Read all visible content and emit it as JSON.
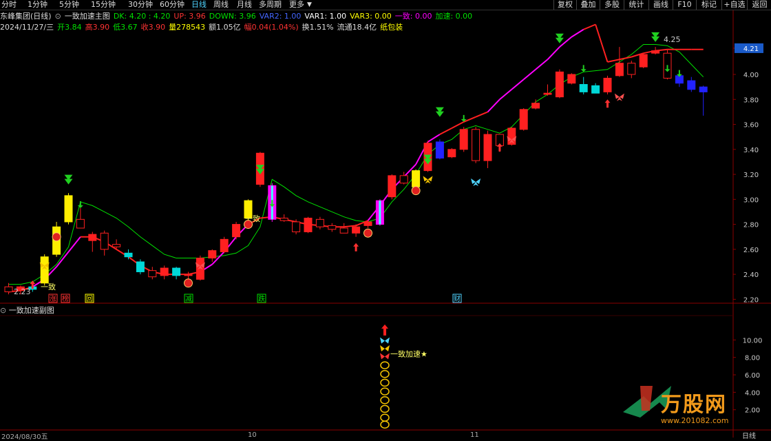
{
  "toolbar": {
    "tabs": [
      "分时",
      "1分钟",
      "5分钟",
      "15分钟",
      "30分钟",
      "60分钟",
      "日线",
      "周线",
      "月线",
      "多周期",
      "更多"
    ],
    "active_tab": "日线",
    "right_buttons": [
      "复权",
      "叠加",
      "多股",
      "统计",
      "画线",
      "F10",
      "标记",
      "+自选",
      "返回"
    ]
  },
  "header": {
    "stock": "东峰集团(日线)",
    "indicator_name": "一致加速主图",
    "values": [
      {
        "label": "DK: 4.20 : 4.20",
        "color": "#00e000"
      },
      {
        "label": "UP: 3.96",
        "color": "#ff3333"
      },
      {
        "label": "DOWN: 3.96",
        "color": "#00e000"
      },
      {
        "label": "VAR2: 1.00",
        "color": "#4466ff"
      },
      {
        "label": "VAR1: 1.00",
        "color": "#ffffff"
      },
      {
        "label": "VAR3: 0.00",
        "color": "#ffff00"
      },
      {
        "label": "一致: 0.00",
        "color": "#ff00ff"
      },
      {
        "label": "加速: 0.00",
        "color": "#00e000"
      }
    ],
    "quote": [
      {
        "label": "2024/11/27/三",
        "color": "#dddddd"
      },
      {
        "label": "开3.84",
        "color": "#00e000"
      },
      {
        "label": "高3.90",
        "color": "#ff3333"
      },
      {
        "label": "低3.67",
        "color": "#00e000"
      },
      {
        "label": "收3.90",
        "color": "#ff3333"
      },
      {
        "label": "量278543",
        "color": "#ffff00"
      },
      {
        "label": "额1.05亿",
        "color": "#dddddd"
      },
      {
        "label": "幅0.04(1.04%)",
        "color": "#ff3333"
      },
      {
        "label": "换1.51%",
        "color": "#dddddd"
      },
      {
        "label": "流通18.4亿",
        "color": "#dddddd"
      },
      {
        "label": "纸包装",
        "color": "#ffff00"
      }
    ]
  },
  "sub_header": "一致加速副图",
  "date_start": "2024/08/30五",
  "month_labels": [
    "10",
    "11"
  ],
  "period_label": "日线",
  "watermark": {
    "text": "万股网",
    "url": "www.201082.com"
  },
  "annotations": {
    "yizhi_1": "一致",
    "yizhi_2": "一致",
    "accel": "一致加速★",
    "start_price": "2.23",
    "end_price": "4.25",
    "last_price": "4.21"
  },
  "event_labels": [
    {
      "text": "涨",
      "color": "#ff3333"
    },
    {
      "text": "榜",
      "color": "#ff3333"
    },
    {
      "text": "回",
      "color": "#ffff00"
    },
    {
      "text": "减",
      "color": "#00e000"
    },
    {
      "text": "跌",
      "color": "#00e000"
    },
    {
      "text": "财",
      "color": "#4fd4ff"
    }
  ],
  "colors": {
    "up": "#ff2020",
    "down": "#00d8d8",
    "yellow": "#ffee00",
    "magenta": "#ff00ff",
    "blue": "#2222ff",
    "ma": "#00e000",
    "trend": "#ff2020",
    "grid": "#8b0000"
  },
  "chart_data": {
    "type": "candlestick",
    "y_range": [
      2.18,
      4.32
    ],
    "y_ticks": [
      "4.21",
      "4.00",
      "3.80",
      "3.60",
      "3.40",
      "3.20",
      "3.00",
      "2.80",
      "2.60",
      "2.40",
      "2.20"
    ],
    "sub_y_range": [
      0,
      12
    ],
    "sub_y_ticks": [
      "10.00",
      "8.00",
      "6.00",
      "4.00",
      "2.00"
    ],
    "candles": [
      {
        "o": 2.3,
        "h": 2.33,
        "l": 2.24,
        "c": 2.26,
        "k": "up"
      },
      {
        "o": 2.27,
        "h": 2.31,
        "l": 2.24,
        "c": 2.3,
        "k": "up"
      },
      {
        "o": 2.3,
        "h": 2.34,
        "l": 2.26,
        "c": 2.28,
        "k": "down"
      },
      {
        "o": 2.33,
        "h": 2.56,
        "l": 2.31,
        "c": 2.54,
        "k": "yel"
      },
      {
        "o": 2.56,
        "h": 2.82,
        "l": 2.54,
        "c": 2.78,
        "k": "yel"
      },
      {
        "o": 2.82,
        "h": 3.05,
        "l": 2.8,
        "c": 3.03,
        "k": "yel"
      },
      {
        "o": 2.84,
        "h": 2.93,
        "l": 2.8,
        "c": 2.77,
        "k": "up"
      },
      {
        "o": 2.67,
        "h": 2.74,
        "l": 2.58,
        "c": 2.72,
        "k": "up"
      },
      {
        "o": 2.73,
        "h": 2.75,
        "l": 2.55,
        "c": 2.6,
        "k": "up"
      },
      {
        "o": 2.64,
        "h": 2.68,
        "l": 2.6,
        "c": 2.62,
        "k": "up"
      },
      {
        "o": 2.57,
        "h": 2.6,
        "l": 2.52,
        "c": 2.54,
        "k": "down"
      },
      {
        "o": 2.5,
        "h": 2.52,
        "l": 2.4,
        "c": 2.42,
        "k": "down"
      },
      {
        "o": 2.43,
        "h": 2.46,
        "l": 2.36,
        "c": 2.38,
        "k": "up"
      },
      {
        "o": 2.39,
        "h": 2.47,
        "l": 2.36,
        "c": 2.45,
        "k": "up"
      },
      {
        "o": 2.45,
        "h": 2.46,
        "l": 2.36,
        "c": 2.39,
        "k": "down"
      },
      {
        "o": 2.39,
        "h": 2.42,
        "l": 2.36,
        "c": 2.4,
        "k": "up"
      },
      {
        "o": 2.36,
        "h": 2.55,
        "l": 2.35,
        "c": 2.53,
        "k": "up"
      },
      {
        "o": 2.53,
        "h": 2.6,
        "l": 2.5,
        "c": 2.59,
        "k": "up"
      },
      {
        "o": 2.58,
        "h": 2.7,
        "l": 2.57,
        "c": 2.68,
        "k": "up"
      },
      {
        "o": 2.7,
        "h": 2.82,
        "l": 2.68,
        "c": 2.8,
        "k": "up"
      },
      {
        "o": 2.85,
        "h": 3.0,
        "l": 2.82,
        "c": 2.99,
        "k": "yel"
      },
      {
        "o": 3.12,
        "h": 3.38,
        "l": 3.1,
        "c": 3.37,
        "k": "up"
      },
      {
        "o": 3.11,
        "h": 3.13,
        "l": 2.82,
        "c": 2.84,
        "k": "mag"
      },
      {
        "o": 2.85,
        "h": 2.88,
        "l": 2.82,
        "c": 2.83,
        "k": "up"
      },
      {
        "o": 2.82,
        "h": 2.84,
        "l": 2.72,
        "c": 2.74,
        "k": "up"
      },
      {
        "o": 2.74,
        "h": 2.86,
        "l": 2.73,
        "c": 2.85,
        "k": "up"
      },
      {
        "o": 2.84,
        "h": 2.86,
        "l": 2.76,
        "c": 2.78,
        "k": "up"
      },
      {
        "o": 2.79,
        "h": 2.81,
        "l": 2.74,
        "c": 2.76,
        "k": "up"
      },
      {
        "o": 2.77,
        "h": 2.81,
        "l": 2.73,
        "c": 2.73,
        "k": "up"
      },
      {
        "o": 2.73,
        "h": 2.8,
        "l": 2.7,
        "c": 2.78,
        "k": "up"
      },
      {
        "o": 2.79,
        "h": 2.83,
        "l": 2.77,
        "c": 2.82,
        "k": "up"
      },
      {
        "o": 2.8,
        "h": 3.0,
        "l": 2.79,
        "c": 2.99,
        "k": "mag"
      },
      {
        "o": 3.02,
        "h": 3.2,
        "l": 3.0,
        "c": 3.19,
        "k": "up"
      },
      {
        "o": 3.19,
        "h": 3.22,
        "l": 3.12,
        "c": 3.13,
        "k": "up"
      },
      {
        "o": 3.1,
        "h": 3.24,
        "l": 3.09,
        "c": 3.23,
        "k": "yel"
      },
      {
        "o": 3.23,
        "h": 3.47,
        "l": 3.22,
        "c": 3.45,
        "k": "up"
      },
      {
        "o": 3.46,
        "h": 3.48,
        "l": 3.32,
        "c": 3.33,
        "k": "blue"
      },
      {
        "o": 3.34,
        "h": 3.41,
        "l": 3.33,
        "c": 3.4,
        "k": "up"
      },
      {
        "o": 3.4,
        "h": 3.58,
        "l": 3.38,
        "c": 3.56,
        "k": "up"
      },
      {
        "o": 3.56,
        "h": 3.58,
        "l": 3.29,
        "c": 3.31,
        "k": "up"
      },
      {
        "o": 3.31,
        "h": 3.55,
        "l": 3.25,
        "c": 3.52,
        "k": "up"
      },
      {
        "o": 3.52,
        "h": 3.48,
        "l": 3.38,
        "c": 3.43,
        "k": "up"
      },
      {
        "o": 3.44,
        "h": 3.58,
        "l": 3.43,
        "c": 3.57,
        "k": "up"
      },
      {
        "o": 3.56,
        "h": 3.73,
        "l": 3.55,
        "c": 3.72,
        "k": "up"
      },
      {
        "o": 3.73,
        "h": 3.8,
        "l": 3.72,
        "c": 3.77,
        "k": "up"
      },
      {
        "o": 3.84,
        "h": 3.92,
        "l": 3.83,
        "c": 3.85,
        "k": "up"
      },
      {
        "o": 3.82,
        "h": 4.04,
        "l": 3.81,
        "c": 4.02,
        "k": "up"
      },
      {
        "o": 3.93,
        "h": 4.01,
        "l": 3.92,
        "c": 4.0,
        "k": "up"
      },
      {
        "o": 3.92,
        "h": 3.98,
        "l": 3.84,
        "c": 3.86,
        "k": "down"
      },
      {
        "o": 3.91,
        "h": 3.93,
        "l": 3.85,
        "c": 3.85,
        "k": "down"
      },
      {
        "o": 3.86,
        "h": 3.99,
        "l": 3.84,
        "c": 3.97,
        "k": "up"
      },
      {
        "o": 3.99,
        "h": 4.22,
        "l": 3.98,
        "c": 4.09,
        "k": "up"
      },
      {
        "o": 4.09,
        "h": 4.11,
        "l": 3.97,
        "c": 4.0,
        "k": "up"
      },
      {
        "o": 4.06,
        "h": 4.17,
        "l": 4.05,
        "c": 4.16,
        "k": "up"
      },
      {
        "o": 4.17,
        "h": 4.22,
        "l": 4.16,
        "c": 4.19,
        "k": "up"
      },
      {
        "o": 4.17,
        "h": 4.2,
        "l": 3.96,
        "c": 3.97,
        "k": "up"
      },
      {
        "o": 3.99,
        "h": 4.02,
        "l": 3.9,
        "c": 3.93,
        "k": "blue"
      },
      {
        "o": 3.95,
        "h": 3.98,
        "l": 3.86,
        "c": 3.88,
        "k": "blue"
      },
      {
        "o": 3.9,
        "h": 3.91,
        "l": 3.67,
        "c": 3.86,
        "k": "blue"
      }
    ],
    "ma_line": [
      2.32,
      2.32,
      2.34,
      2.4,
      2.48,
      2.62,
      2.98,
      2.95,
      2.9,
      2.85,
      2.78,
      2.7,
      2.63,
      2.56,
      2.53,
      2.53,
      2.53,
      2.54,
      2.55,
      2.57,
      2.63,
      2.78,
      3.16,
      3.1,
      3.03,
      2.98,
      2.94,
      2.9,
      2.86,
      2.83,
      2.82,
      2.85,
      2.98,
      3.08,
      3.2,
      3.36,
      3.44,
      3.48,
      3.56,
      3.59,
      3.56,
      3.53,
      3.58,
      3.68,
      3.78,
      3.84,
      3.92,
      3.98,
      4.02,
      4.03,
      4.04,
      4.1,
      4.16,
      4.24,
      4.24,
      4.23,
      4.18,
      4.08,
      3.98
    ],
    "trend_line": [
      2.26,
      2.27,
      2.3,
      2.36,
      2.46,
      2.58,
      2.7,
      2.7,
      2.66,
      2.6,
      2.54,
      2.47,
      2.42,
      2.4,
      2.4,
      2.4,
      2.42,
      2.48,
      2.58,
      2.7,
      2.8,
      2.85,
      2.86,
      2.84,
      2.82,
      2.8,
      2.79,
      2.78,
      2.78,
      2.79,
      2.83,
      2.95,
      3.08,
      3.18,
      3.28,
      3.46,
      3.52,
      3.57,
      3.62,
      3.66,
      3.7,
      3.8,
      3.88,
      3.96,
      4.04,
      4.12,
      4.22,
      4.3,
      4.36,
      4.4,
      4.1,
      4.12,
      4.14,
      4.17,
      4.19,
      4.2,
      4.2,
      4.2,
      4.2
    ],
    "sub_signals": [
      {
        "icon": "arrow",
        "value": 11.3,
        "color": "#ff2020"
      },
      {
        "icon": "butterfly",
        "value": 9.9,
        "color": "#4fd4ff"
      },
      {
        "icon": "butterfly",
        "value": 9.0,
        "color": "#f2c200"
      },
      {
        "icon": "butterfly",
        "value": 8.1,
        "color": "#ff3333"
      },
      {
        "icon": "coin",
        "value": 7.1,
        "color": "#f2c200"
      },
      {
        "icon": "coin",
        "value": 6.1,
        "color": "#f2c200"
      },
      {
        "icon": "coin",
        "value": 5.1,
        "color": "#f2c200"
      },
      {
        "icon": "coin",
        "value": 4.1,
        "color": "#f2c200"
      },
      {
        "icon": "coin",
        "value": 3.1,
        "color": "#f2c200"
      },
      {
        "icon": "coin",
        "value": 2.1,
        "color": "#f2c200"
      },
      {
        "icon": "coin",
        "value": 1.1,
        "color": "#f2c200"
      },
      {
        "icon": "coin",
        "value": 0.3,
        "color": "#f2c200"
      }
    ]
  }
}
